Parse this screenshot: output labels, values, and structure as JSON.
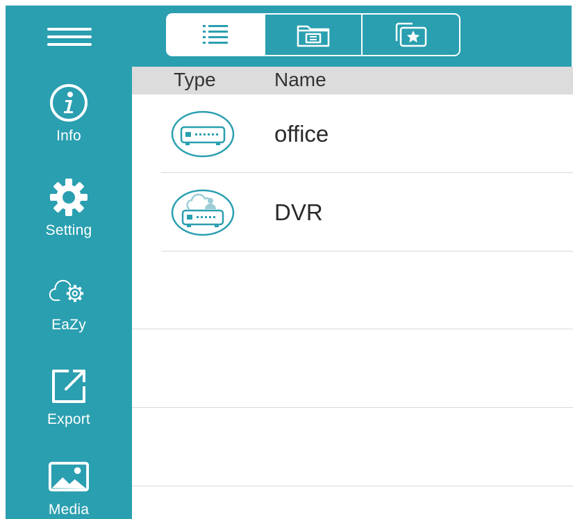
{
  "topbar": {
    "menu_icon": "hamburger-icon",
    "tabs": [
      {
        "icon": "list-icon",
        "active": true
      },
      {
        "icon": "folder-icon",
        "active": false
      },
      {
        "icon": "favorites-icon",
        "active": false
      }
    ]
  },
  "sidebar": {
    "items": [
      {
        "label": "Info",
        "icon": "info-icon"
      },
      {
        "label": "Setting",
        "icon": "gear-icon"
      },
      {
        "label": "EaZy",
        "icon": "cloud-gear-icon"
      },
      {
        "label": "Export",
        "icon": "export-icon"
      },
      {
        "label": "Media",
        "icon": "image-icon"
      }
    ]
  },
  "table": {
    "headers": {
      "type": "Type",
      "name": "Name"
    },
    "rows": [
      {
        "name": "office",
        "icon": "dvr-device-icon"
      },
      {
        "name": "DVR",
        "icon": "cloud-dvr-device-icon"
      }
    ]
  },
  "colors": {
    "accent": "#2a9fb0",
    "header_bg": "#dcdcdc",
    "divider": "#d8d8d8"
  }
}
